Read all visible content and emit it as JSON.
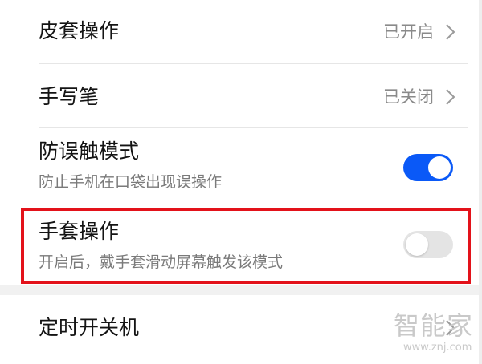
{
  "settings": {
    "leather_case": {
      "title": "皮套操作",
      "value": "已开启"
    },
    "stylus": {
      "title": "手写笔",
      "value": "已关闭"
    },
    "accidental_touch": {
      "title": "防误触模式",
      "subtitle": "防止手机在口袋出现误操作",
      "enabled": true
    },
    "glove_mode": {
      "title": "手套操作",
      "subtitle": "开启后，戴手套滑动屏幕触发该模式",
      "enabled": false
    },
    "scheduled_power": {
      "title": "定时开关机"
    }
  },
  "watermark": {
    "text": "智能家",
    "url": "www.znj.com"
  },
  "colors": {
    "toggle_on": "#0a59f7",
    "toggle_off": "#e4e4e4",
    "highlight_border": "#e3121a"
  }
}
